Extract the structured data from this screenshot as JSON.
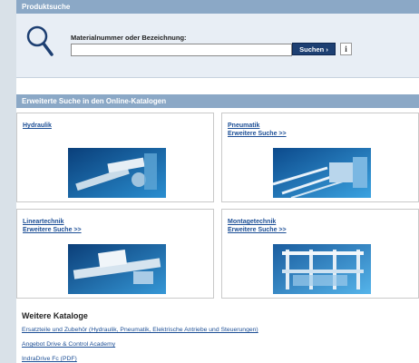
{
  "product_search": {
    "header": "Produktsuche",
    "label": "Materialnummer oder Bezeichnung:",
    "input_value": "",
    "search_button": "Suchen ›",
    "info_button": "i"
  },
  "advanced": {
    "header": "Erweiterte Suche in den Online-Katalogen",
    "cards": [
      {
        "title": "Hydraulik",
        "link": ""
      },
      {
        "title": "Pneumatik",
        "link": "Erweitere Suche >>"
      },
      {
        "title": "Lineartechnik",
        "link": "Erweitere Suche >>"
      },
      {
        "title": "Montagetechnik",
        "link": "Erweitere Suche >>"
      }
    ]
  },
  "more_catalogs": {
    "title": "Weitere Kataloge",
    "links": [
      "Ersatzteile und Zubehör (Hydraulik, Pneumatik, Elektrische Antriebe und Steuerungen)",
      "Angebot Drive & Control Academy",
      "IndraDrive Fc (PDF)"
    ]
  },
  "colors": {
    "header_bar": "#8ba8c6",
    "panel_bg": "#e8eef5",
    "link": "#1d4f96",
    "button": "#1d3f72"
  }
}
